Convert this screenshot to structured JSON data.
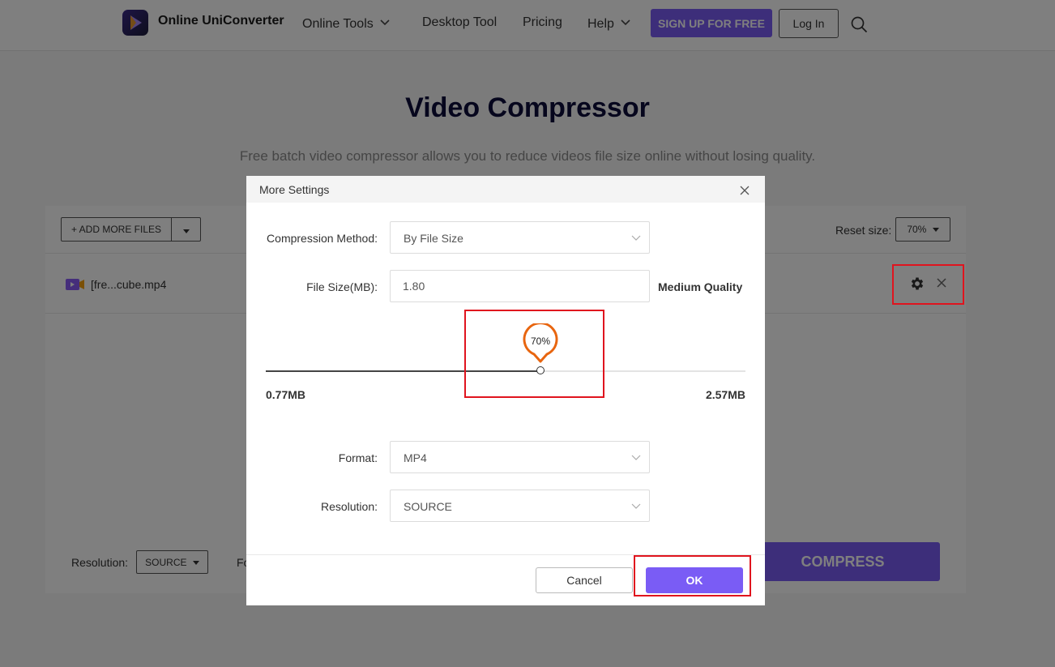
{
  "header": {
    "brand": "Online UniConverter",
    "nav": {
      "online_tools": "Online Tools",
      "desktop_tool": "Desktop Tool",
      "pricing": "Pricing",
      "help": "Help"
    },
    "signup_label": "SIGN UP FOR FREE",
    "login_label": "Log In"
  },
  "page": {
    "title": "Video Compressor",
    "subtitle": "Free batch video compressor allows you to reduce videos file size online without losing quality."
  },
  "panel": {
    "add_files_label": "+ ADD MORE FILES",
    "reset_size_label": "Reset size:",
    "reset_size_value": "70%",
    "file_name": "[fre...cube.mp4",
    "resolution_label": "Resolution:",
    "resolution_value": "SOURCE",
    "format_label_partial": "Fo",
    "compress_label": "COMPRESS"
  },
  "modal": {
    "title": "More Settings",
    "compression_method_label": "Compression Method:",
    "compression_method_value": "By File Size",
    "file_size_label": "File Size(MB):",
    "file_size_value": "1.80",
    "quality_label": "Medium Quality",
    "slider_percent": 70,
    "slider_label": "70%",
    "min_label": "0.77MB",
    "max_label": "2.57MB",
    "format_label": "Format:",
    "format_value": "MP4",
    "resolution_label": "Resolution:",
    "resolution_value": "SOURCE",
    "cancel_label": "Cancel",
    "ok_label": "OK"
  },
  "colors": {
    "accent": "#7a5cf5",
    "slider_marker": "#e8650f",
    "highlight": "#e0141e",
    "title": "#0c0c3a"
  }
}
